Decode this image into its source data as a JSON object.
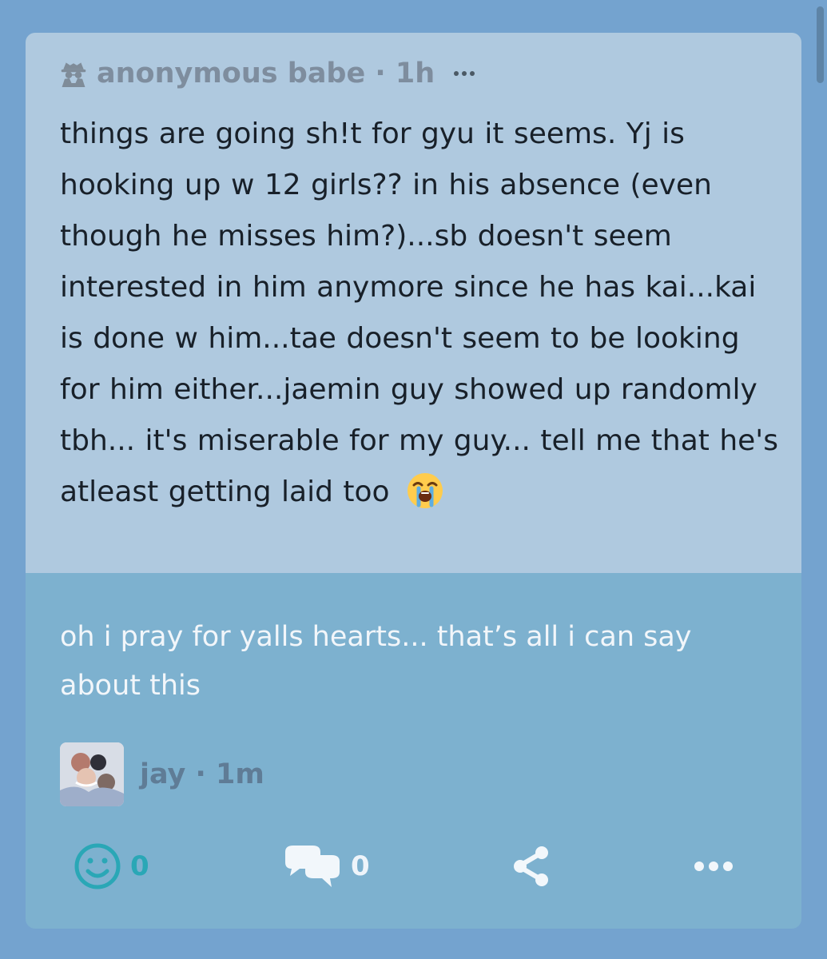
{
  "post": {
    "author": "anonymous babe",
    "time": "1h",
    "text": "things are going sh!t for gyu it seems. Yj is hooking up w 12 girls?? in his absence (even though he misses him?)...sb doesn't seem interested in him anymore since he has kai...kai is done w him...tae doesn't seem to be looking for him either...jaemin guy showed up randomly tbh... it's miserable for my guy... tell me that he's atleast getting laid too",
    "emoji": "loudly-crying-face"
  },
  "answer": {
    "text": "oh i pray for yalls hearts... that’s all i can say about this",
    "author": "jay",
    "time": "1m"
  },
  "actions": {
    "smile_count": "0",
    "comment_count": "0"
  },
  "icons": {
    "spy": "spy-icon",
    "more": "more-icon",
    "smile": "smile-icon",
    "comments": "comment-bubbles-icon",
    "share": "share-icon"
  },
  "colors": {
    "background": "#74a3cf",
    "question_card": "#afc9df",
    "answer_card": "#7db1cf",
    "accent": "#2aa7b6"
  }
}
